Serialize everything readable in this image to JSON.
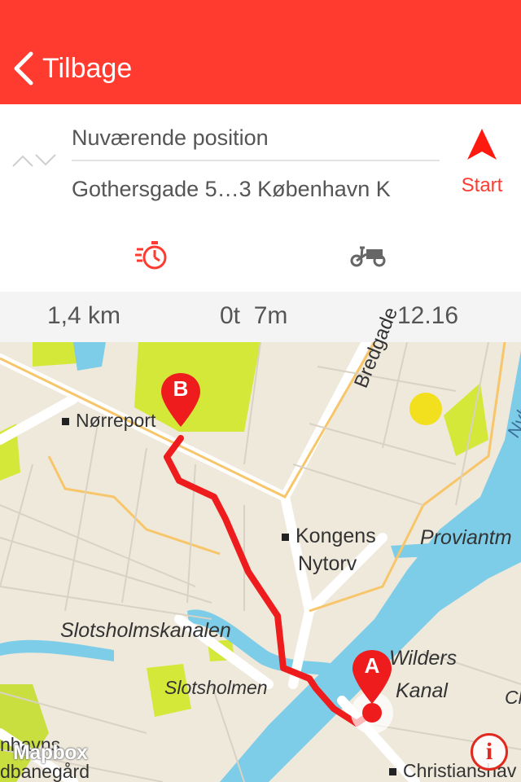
{
  "nav": {
    "back_label": "Tilbage",
    "bar_color": "#ff3b30"
  },
  "route": {
    "from_value": "Nuværende position",
    "to_value": "Gothersgade 5…3 København K",
    "start_label": "Start",
    "swap_icon": "swap-icon"
  },
  "modes": {
    "selected": "fast",
    "items": [
      {
        "icon": "stopwatch-fast-icon",
        "selected": true
      },
      {
        "icon": "cargo-bike-icon",
        "selected": false
      }
    ]
  },
  "stats": {
    "distance": "1,4 km",
    "duration": "0t  7m",
    "arrival": "12.16"
  },
  "map": {
    "labels": {
      "norreport": "Nørreport",
      "bredgade": "Bredgade",
      "nyhavn": "Nyhavn",
      "kongens": "Kongens",
      "nytorv": "Nytorv",
      "proviant": "Proviantm",
      "slotsholmskanalen": "Slotsholmskanalen",
      "slotsholmen": "Slotsholmen",
      "wilders": "Wilders",
      "kanal": "Kanal",
      "ch": "Ch",
      "christianshavn": "Christianshav",
      "left_partial_1": "nhavns",
      "left_partial_2": "dbanegård"
    },
    "marker_start": "A",
    "marker_end": "B",
    "attribution": "Mapbox",
    "route_color": "#ee1c1c",
    "water_color": "#7dcde8",
    "park_color": "#d4e83a"
  }
}
